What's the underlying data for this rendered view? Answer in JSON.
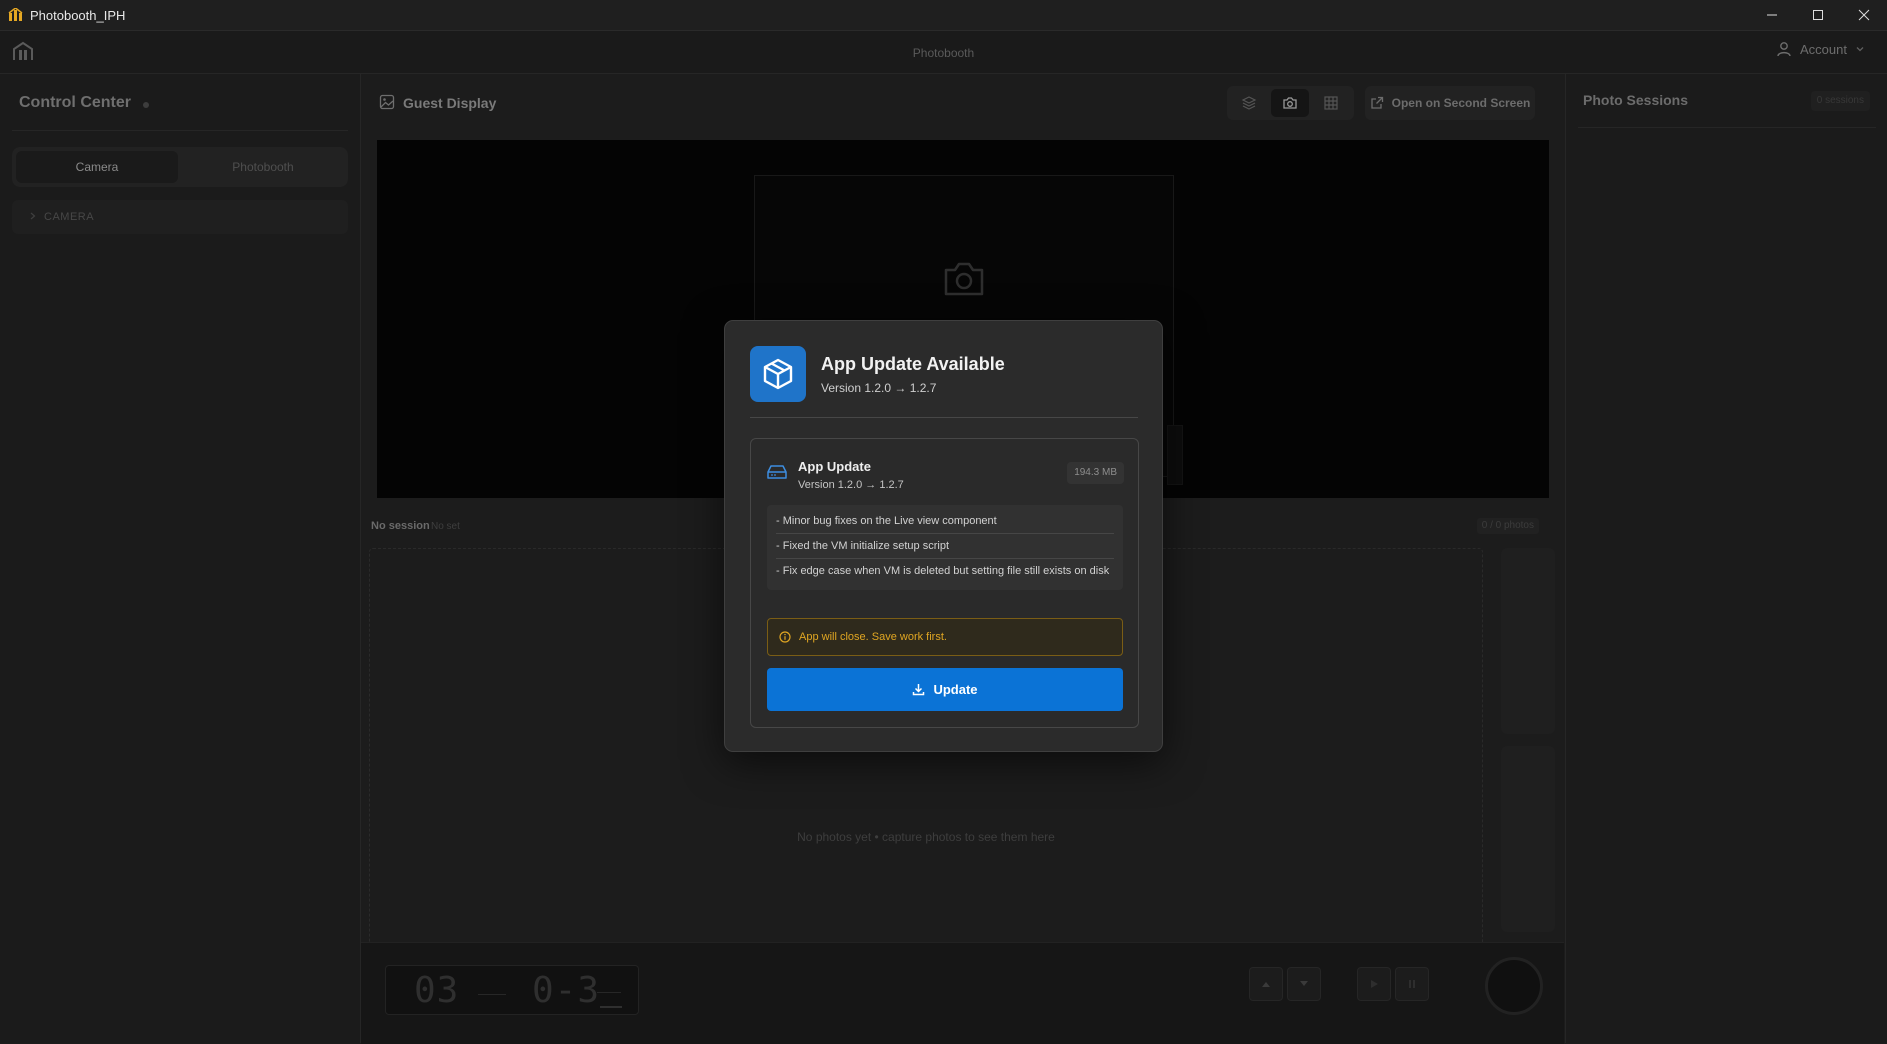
{
  "window": {
    "title": "Photobooth_IPH"
  },
  "appbar": {
    "title": "Photobooth",
    "account_label": "Account"
  },
  "left": {
    "title": "Control Center",
    "tabs": [
      {
        "label": "Camera",
        "active": true
      },
      {
        "label": "Photobooth",
        "active": false
      }
    ],
    "section_label": "CAMERA"
  },
  "center": {
    "title": "Guest Display",
    "open_second_screen": "Open on Second Screen",
    "session_label": "No session",
    "session_set": "No set",
    "photo_count": "0 / 0 photos",
    "empty_text": "No photos yet • capture photos to see them here",
    "lcd_left": "03",
    "lcd_right": "0-3"
  },
  "right": {
    "title": "Photo Sessions",
    "count": "0 sessions"
  },
  "modal": {
    "title": "App Update Available",
    "version": "Version 1.2.0 → 1.2.7",
    "card": {
      "title": "App Update",
      "version": "Version 1.2.0 → 1.2.7",
      "size": "194.3 MB",
      "notes": [
        "- Minor bug fixes on the Live view component",
        "- Fixed the VM initialize setup script",
        "- Fix edge case when VM is deleted but setting file still exists on disk"
      ]
    },
    "warning": "App will close. Save work first.",
    "update_button": "Update"
  },
  "colors": {
    "accent": "#0b73d6",
    "warning": "#e0a622",
    "icon_bg": "#1f74c9"
  },
  "icons": [
    "app-logo-icon",
    "minimize-icon",
    "maximize-icon",
    "close-icon",
    "user-icon",
    "chevron-down-icon",
    "image-icon",
    "layers-icon",
    "camera-icon",
    "grid-icon",
    "external-link-icon",
    "package-icon",
    "drive-icon",
    "info-icon",
    "download-icon"
  ]
}
